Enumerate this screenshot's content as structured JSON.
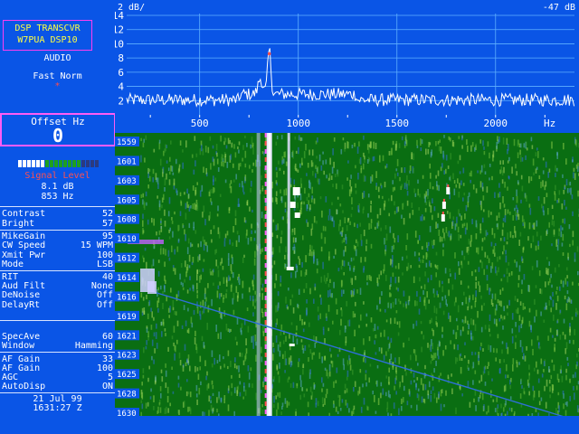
{
  "app": {
    "title_line1": "DSP TRANSCVR",
    "title_line2": "W7PUA DSP10"
  },
  "audio": {
    "label": "AUDIO",
    "mode": "Fast Norm",
    "indicator": "*"
  },
  "offset": {
    "label": "Offset Hz",
    "value": "0"
  },
  "signal": {
    "label": "Signal Level",
    "db": "8.1 dB",
    "hz": "853 Hz",
    "meter_level": 0.8
  },
  "display_settings": [
    {
      "name": "Contrast",
      "value": "52"
    },
    {
      "name": "Bright",
      "value": "57"
    }
  ],
  "tx_settings": [
    {
      "name": "MikeGain",
      "value": "95"
    },
    {
      "name": "CW Speed",
      "value": "15 WPM"
    },
    {
      "name": "Xmit Pwr",
      "value": "100"
    },
    {
      "name": "Mode",
      "value": "LSB"
    }
  ],
  "rx_settings": [
    {
      "name": "RIT",
      "value": "40"
    },
    {
      "name": "Aud Filt",
      "value": "None"
    },
    {
      "name": "DeNoise",
      "value": "Off"
    },
    {
      "name": "DelayRt",
      "value": "Off"
    }
  ],
  "spec_settings": [
    {
      "name": "SpecAve",
      "value": "60"
    },
    {
      "name": "Window",
      "value": "Hamming"
    }
  ],
  "gain_settings": [
    {
      "name": "AF Gain",
      "value": "33"
    },
    {
      "name": "AF Gain",
      "value": "100"
    },
    {
      "name": "AGC",
      "value": "5"
    },
    {
      "name": "AutoDisp",
      "value": "ON"
    }
  ],
  "datetime": {
    "date": "21 Jul 99",
    "time": "1631:27 Z"
  },
  "spectrum": {
    "scale_label": "2 dB/",
    "ref_label": "-47 dB",
    "hz_label": "Hz",
    "y_ticks": [
      "14",
      "12",
      "10",
      "8",
      "6",
      "4",
      "2"
    ],
    "x_ticks": [
      "500",
      "1000",
      "1500",
      "2000"
    ],
    "peak_hz": 853
  },
  "waterfall": {
    "time_labels": [
      "1559",
      "1601",
      "1603",
      "1605",
      "1608",
      "1610",
      "1612",
      "1614",
      "1616",
      "1619",
      "1621",
      "1623",
      "1625",
      "1628",
      "1630"
    ]
  },
  "colors": {
    "panel_blue": "#0a55e6",
    "waterfall_green": "#0a6e12",
    "title_yellow": "#ffff40",
    "border_magenta": "#ff5cf4",
    "signal_red": "#ff4b4b"
  }
}
